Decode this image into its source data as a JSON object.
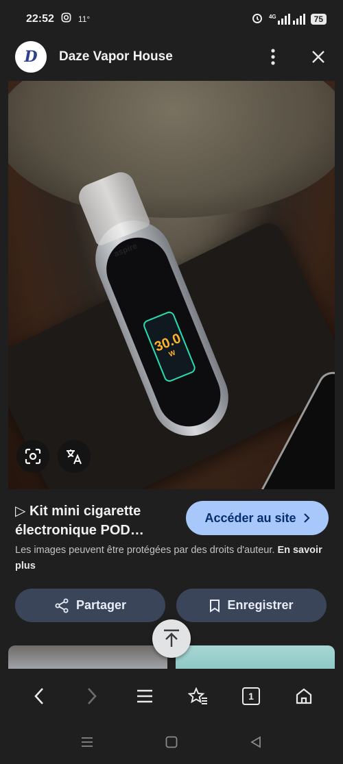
{
  "status_bar": {
    "time": "22:52",
    "temperature": "11°",
    "network": "4G",
    "battery": "75"
  },
  "header": {
    "site_logo_letter": "D",
    "site_name": "Daze Vapor House"
  },
  "photo": {
    "device_brand": "aspire",
    "screen_value": "30.0",
    "screen_unit": "W"
  },
  "result": {
    "title_line1": "▷ Kit mini cigarette",
    "title_line2": "électronique POD…",
    "visit_label": "Accéder au site",
    "copyright_text": "Les images peuvent être protégées par des droits d'auteur.",
    "learn_more": "En savoir plus"
  },
  "actions": {
    "share_label": "Partager",
    "save_label": "Enregistrer"
  },
  "bottom_nav": {
    "tab_count": "1"
  },
  "colors": {
    "accent_button": "#a8c7fa",
    "action_button": "#3b4559",
    "background": "#1f1f1f"
  }
}
